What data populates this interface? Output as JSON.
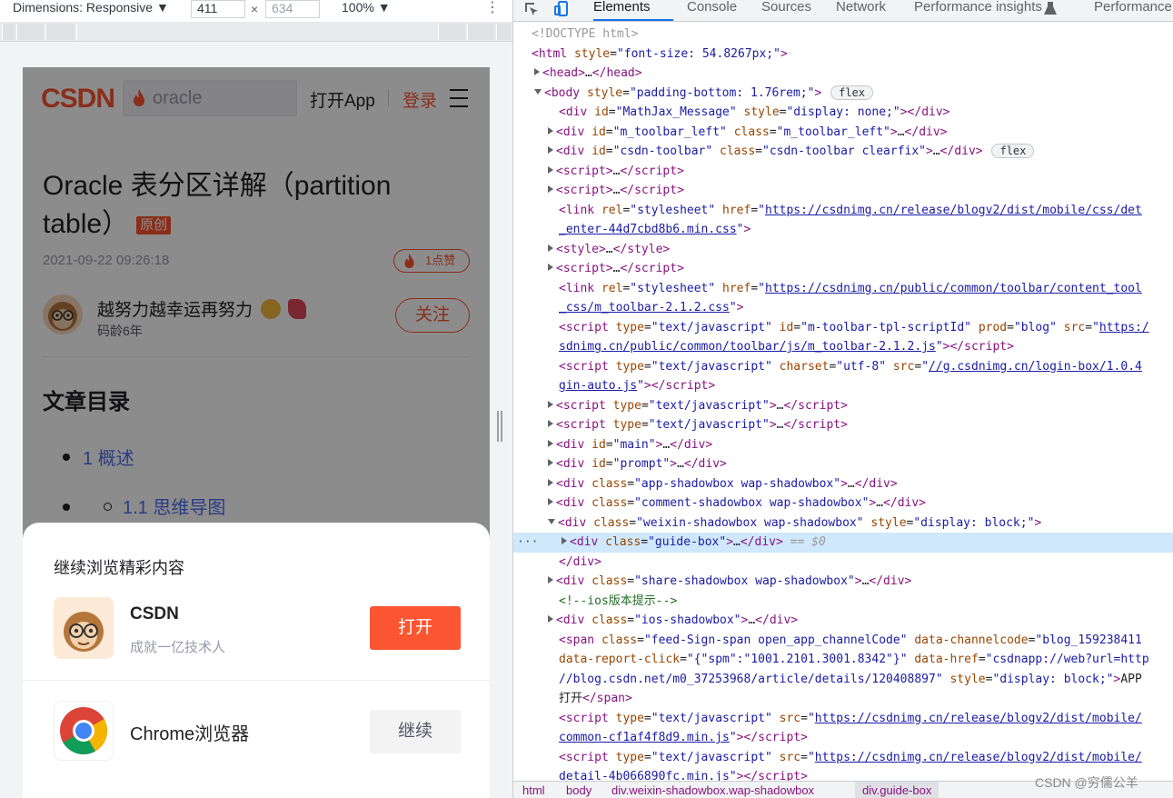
{
  "device_toolbar": {
    "dimensions_label": "Dimensions: Responsive ▼",
    "width_value": "411",
    "height_placeholder": "634",
    "times": "×",
    "zoom_label": "100% ▼",
    "more": "⋮"
  },
  "mobile_page": {
    "logo": "CSDN",
    "search_text": "oracle",
    "open_app": "打开App",
    "login": "登录",
    "title": "Oracle 表分区详解（partition table）",
    "original_tag": "原创",
    "date": "2021-09-22 09:26:18",
    "likes": "1点赞",
    "author_name": "越努力越幸运再努力",
    "author_age": "码龄6年",
    "follow": "关注",
    "toc_title": "文章目录",
    "toc_items": [
      "1 概述",
      "1.1 思维导图"
    ]
  },
  "sheet": {
    "heading": "继续浏览精彩内容",
    "app_name": "CSDN",
    "app_tagline": "成就一亿技术人",
    "open_button": "打开",
    "browser_name": "Chrome浏览器",
    "continue_button": "继续"
  },
  "devtools": {
    "tabs": [
      "Elements",
      "Console",
      "Sources",
      "Network",
      "Performance insights",
      "Performance"
    ],
    "active_tab": "Elements",
    "lines": [
      {
        "i": 0,
        "t": "none",
        "h": "<span class='gr'>&lt;!DOCTYPE html&gt;</span>"
      },
      {
        "i": 0,
        "t": "none",
        "h": "<span class='tg'>&lt;html</span> <span class='at'>style</span>=<span class='av'>\"font-size: 54.8267px;\"</span><span class='tg'>&gt;</span>"
      },
      {
        "i": 1,
        "t": "right",
        "h": "<span class='tg'>&lt;head&gt;</span>…<span class='tg'>&lt;/head&gt;</span>"
      },
      {
        "i": 1,
        "t": "down",
        "h": "<span class='tg'>&lt;body</span> <span class='at'>style</span>=<span class='av'>\"padding-bottom: 1.76rem;\"</span><span class='tg'>&gt;</span> <span class='pill'>flex</span>"
      },
      {
        "i": 2,
        "t": "none",
        "h": "<span class='tg'>&lt;div</span> <span class='at'>id</span>=<span class='av'>\"MathJax_Message\"</span> <span class='at'>style</span>=<span class='av'>\"display: none;\"</span><span class='tg'>&gt;&lt;/div&gt;</span>"
      },
      {
        "i": 2,
        "t": "right",
        "h": "<span class='tg'>&lt;div</span> <span class='at'>id</span>=<span class='av'>\"m_toolbar_left\"</span> <span class='at'>class</span>=<span class='av'>\"m_toolbar_left\"</span><span class='tg'>&gt;</span>…<span class='tg'>&lt;/div&gt;</span>"
      },
      {
        "i": 2,
        "t": "right",
        "h": "<span class='tg'>&lt;div</span> <span class='at'>id</span>=<span class='av'>\"csdn-toolbar\"</span> <span class='at'>class</span>=<span class='av'>\"csdn-toolbar clearfix\"</span><span class='tg'>&gt;</span>…<span class='tg'>&lt;/div&gt;</span> <span class='pill'>flex</span>"
      },
      {
        "i": 2,
        "t": "right",
        "h": "<span class='tg'>&lt;script&gt;</span>…<span class='tg'>&lt;/script&gt;</span>"
      },
      {
        "i": 2,
        "t": "right",
        "h": "<span class='tg'>&lt;script&gt;</span>…<span class='tg'>&lt;/script&gt;</span>"
      },
      {
        "i": 2,
        "t": "none",
        "h": "<span class='tg'>&lt;link</span> <span class='at'>rel</span>=<span class='av'>\"stylesheet\"</span> <span class='at'>href</span>=<span class='av'>\"</span><span class='lk'>https://csdnimg.cn/release/blogv2/dist/mobile/css/det</span>"
      },
      {
        "i": 2,
        "t": "none",
        "h": "<span class='lk'>_enter-44d7cbd8b6.min.css</span><span class='av'>\"</span><span class='tg'>&gt;</span>"
      },
      {
        "i": 2,
        "t": "right",
        "h": "<span class='tg'>&lt;style&gt;</span>…<span class='tg'>&lt;/style&gt;</span>"
      },
      {
        "i": 2,
        "t": "right",
        "h": "<span class='tg'>&lt;script&gt;</span>…<span class='tg'>&lt;/script&gt;</span>"
      },
      {
        "i": 2,
        "t": "none",
        "h": "<span class='tg'>&lt;link</span> <span class='at'>rel</span>=<span class='av'>\"stylesheet\"</span> <span class='at'>href</span>=<span class='av'>\"</span><span class='lk'>https://csdnimg.cn/public/common/toolbar/content_tool</span>"
      },
      {
        "i": 2,
        "t": "none",
        "h": "<span class='lk'>_css/m_toolbar-2.1.2.css</span><span class='av'>\"</span><span class='tg'>&gt;</span>"
      },
      {
        "i": 2,
        "t": "none",
        "h": "<span class='tg'>&lt;script</span> <span class='at'>type</span>=<span class='av'>\"text/javascript\"</span> <span class='at'>id</span>=<span class='av'>\"m-toolbar-tpl-scriptId\"</span> <span class='at'>prod</span>=<span class='av'>\"blog\"</span> <span class='at'>src</span>=<span class='av'>\"</span><span class='lk'>https:/</span>"
      },
      {
        "i": 2,
        "t": "none",
        "h": "<span class='lk'>sdnimg.cn/public/common/toolbar/js/m_toolbar-2.1.2.js</span><span class='av'>\"</span><span class='tg'>&gt;&lt;/script&gt;</span>"
      },
      {
        "i": 2,
        "t": "none",
        "h": "<span class='tg'>&lt;script</span> <span class='at'>type</span>=<span class='av'>\"text/javascript\"</span> <span class='at'>charset</span>=<span class='av'>\"utf-8\"</span> <span class='at'>src</span>=<span class='av'>\"</span><span class='lk'>//g.csdnimg.cn/login-box/1.0.4</span>"
      },
      {
        "i": 2,
        "t": "none",
        "h": "<span class='lk'>gin-auto.js</span><span class='av'>\"</span><span class='tg'>&gt;&lt;/script&gt;</span>"
      },
      {
        "i": 2,
        "t": "right",
        "h": "<span class='tg'>&lt;script</span> <span class='at'>type</span>=<span class='av'>\"text/javascript\"</span><span class='tg'>&gt;</span>…<span class='tg'>&lt;/script&gt;</span>"
      },
      {
        "i": 2,
        "t": "right",
        "h": "<span class='tg'>&lt;script</span> <span class='at'>type</span>=<span class='av'>\"text/javascript\"</span><span class='tg'>&gt;</span>…<span class='tg'>&lt;/script&gt;</span>"
      },
      {
        "i": 2,
        "t": "right",
        "h": "<span class='tg'>&lt;div</span> <span class='at'>id</span>=<span class='av'>\"main\"</span><span class='tg'>&gt;</span>…<span class='tg'>&lt;/div&gt;</span>"
      },
      {
        "i": 2,
        "t": "right",
        "h": "<span class='tg'>&lt;div</span> <span class='at'>id</span>=<span class='av'>\"prompt\"</span><span class='tg'>&gt;</span>…<span class='tg'>&lt;/div&gt;</span>"
      },
      {
        "i": 2,
        "t": "right",
        "h": "<span class='tg'>&lt;div</span> <span class='at'>class</span>=<span class='av'>\"app-shadowbox wap-shadowbox\"</span><span class='tg'>&gt;</span>…<span class='tg'>&lt;/div&gt;</span>"
      },
      {
        "i": 2,
        "t": "right",
        "h": "<span class='tg'>&lt;div</span> <span class='at'>class</span>=<span class='av'>\"comment-shadowbox wap-shadowbox\"</span><span class='tg'>&gt;</span>…<span class='tg'>&lt;/div&gt;</span>"
      },
      {
        "i": 2,
        "t": "down",
        "h": "<span class='tg'>&lt;div</span> <span class='at'>class</span>=<span class='av'>\"weixin-shadowbox wap-shadowbox\"</span> <span class='at'>style</span>=<span class='av'>\"display: block;\"</span><span class='tg'>&gt;</span>"
      },
      {
        "i": 3,
        "t": "right",
        "sel": true,
        "h": "<span class='tg'>&lt;div</span> <span class='at'>class</span>=<span class='av'>\"guide-box\"</span><span class='tg'>&gt;</span>…<span class='tg'>&lt;/div&gt;</span> <span class='gr'>== <i>$0</i></span>"
      },
      {
        "i": 2,
        "t": "none",
        "h": "<span class='tg'>&lt;/div&gt;</span>"
      },
      {
        "i": 2,
        "t": "right",
        "h": "<span class='tg'>&lt;div</span> <span class='at'>class</span>=<span class='av'>\"share-shadowbox wap-shadowbox\"</span><span class='tg'>&gt;</span>…<span class='tg'>&lt;/div&gt;</span>"
      },
      {
        "i": 2,
        "t": "none",
        "h": "<span class='cm'>&lt;!--ios版本提示--&gt;</span>"
      },
      {
        "i": 2,
        "t": "right",
        "h": "<span class='tg'>&lt;div</span> <span class='at'>class</span>=<span class='av'>\"ios-shadowbox\"</span><span class='tg'>&gt;</span>…<span class='tg'>&lt;/div&gt;</span>"
      },
      {
        "i": 2,
        "t": "none",
        "h": "<span class='tg'>&lt;span</span> <span class='at'>class</span>=<span class='av'>\"feed-Sign-span open_app_channelCode\"</span> <span class='at'>data-channelcode</span>=<span class='av'>\"blog_159238411</span>"
      },
      {
        "i": 2,
        "t": "none",
        "h": "<span class='at'>data-report-click</span>=<span class='av'>\"{\"spm\":\"1001.2101.3001.8342\"}\"</span> <span class='at'>data-href</span>=<span class='av'>\"csdnapp://web?url=http</span>"
      },
      {
        "i": 2,
        "t": "none",
        "h": "<span class='av'>//blog.csdn.net/m0_37253968/article/details/120408897\"</span> <span class='at'>style</span>=<span class='av'>\"display: block;\"</span><span class='tg'>&gt;</span>APP"
      },
      {
        "i": 2,
        "t": "none",
        "h": "打开<span class='tg'>&lt;/span&gt;</span>"
      },
      {
        "i": 2,
        "t": "none",
        "h": "<span class='tg'>&lt;script</span> <span class='at'>type</span>=<span class='av'>\"text/javascript\"</span> <span class='at'>src</span>=<span class='av'>\"</span><span class='lk'>https://csdnimg.cn/release/blogv2/dist/mobile/</span>"
      },
      {
        "i": 2,
        "t": "none",
        "h": "<span class='lk'>common-cf1af4f8d9.min.js</span><span class='av'>\"</span><span class='tg'>&gt;&lt;/script&gt;</span>"
      },
      {
        "i": 2,
        "t": "none",
        "h": "<span class='tg'>&lt;script</span> <span class='at'>type</span>=<span class='av'>\"text/javascript\"</span> <span class='at'>src</span>=<span class='av'>\"</span><span class='lk'>https://csdnimg.cn/release/blogv2/dist/mobile/</span>"
      },
      {
        "i": 2,
        "t": "none",
        "h": "<span class='lk'>detail-4b066890fc.min.js</span><span class='av'>\"</span><span class='tg'>&gt;&lt;/script&gt;</span>"
      }
    ],
    "breadcrumbs": [
      "html",
      "body",
      "div.weixin-shadowbox.wap-shadowbox",
      "div.guide-box"
    ]
  },
  "watermark": "CSDN @穷儒公羊"
}
